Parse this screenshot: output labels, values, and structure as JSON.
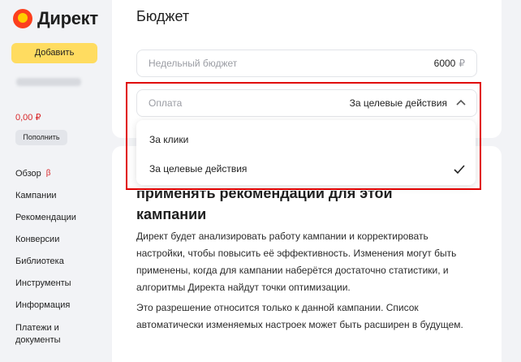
{
  "sidebar": {
    "logo_text": "Директ",
    "add_button": "Добавить",
    "balance": "0,00 ₽",
    "topup_button": "Пополнить",
    "nav": [
      {
        "label": "Обзор",
        "badge": "β"
      },
      {
        "label": "Кампании",
        "badge": ""
      },
      {
        "label": "Рекомендации",
        "badge": ""
      },
      {
        "label": "Конверсии",
        "badge": ""
      },
      {
        "label": "Библиотека",
        "badge": ""
      },
      {
        "label": "Инструменты",
        "badge": ""
      },
      {
        "label": "Информация",
        "badge": ""
      },
      {
        "label": "Платежи и документы",
        "badge": ""
      }
    ]
  },
  "budget": {
    "title": "Бюджет",
    "weekly": {
      "placeholder": "Недельный бюджет",
      "value": "6000",
      "currency": "₽"
    },
    "payment": {
      "placeholder": "Оплата",
      "selected": "За целевые действия",
      "options": [
        "За клики",
        "За целевые действия"
      ]
    }
  },
  "recommendations": {
    "heading_line1": "применять рекомендации для этой",
    "heading_line2": "кампании",
    "paragraph1": "Директ будет анализировать работу кампании и корректировать настройки, чтобы повысить её эффективность. Изменения могут быть применены, когда для кампании наберётся достаточно статистики, и алгоритмы Директа найдут точки оптимизации.",
    "paragraph2": "Это разрешение относится только к данной кампании. Список автоматически изменяемых настроек может быть расширен в будущем."
  },
  "colors": {
    "accent_yellow": "#ffdc60",
    "balance_red": "#d8282b",
    "highlight_red": "#e00000"
  }
}
